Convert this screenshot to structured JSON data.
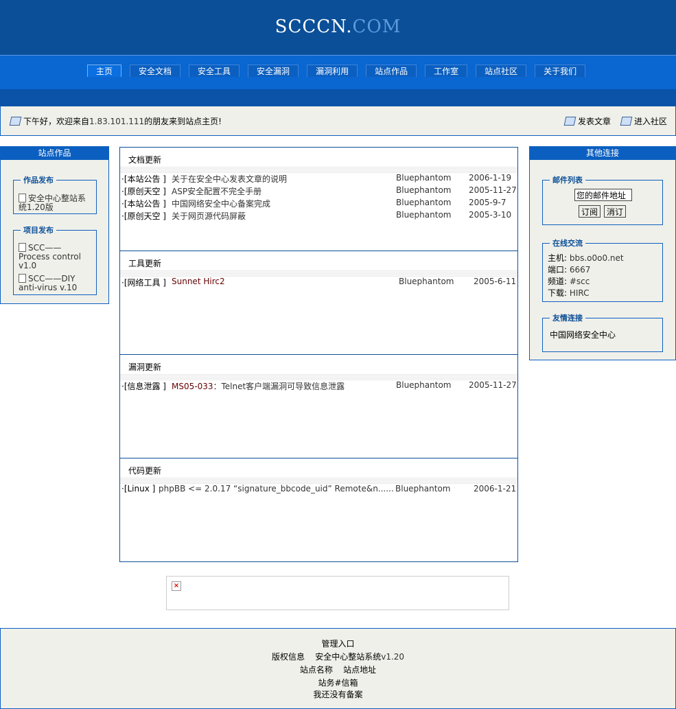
{
  "header": {
    "logo_part1": "SCCCN.",
    "logo_part2": "COM"
  },
  "nav": [
    "主页",
    "安全文档",
    "安全工具",
    "安全漏洞",
    "漏洞利用",
    "站点作品",
    "工作室",
    "站点社区",
    "关于我们"
  ],
  "welcome": {
    "pre": "下午好，欢迎来自",
    "ip": "1.83.101.111",
    "post": "的朋友来到站点主页!",
    "post_article": "发表文章",
    "enter_community": "进入社区"
  },
  "left": {
    "title": "站点作品",
    "works_legend": "作品发布",
    "works_item_line1": "安全中心整站系",
    "works_item_line2": "统1.20版",
    "projects_legend": "项目发布",
    "proj1_line1": "SCC——",
    "proj1_line2": "Process control",
    "proj1_line3": "v1.0",
    "proj2_line1": "SCC——DIY",
    "proj2_line2": "anti-virus v.10"
  },
  "panels": {
    "docs": {
      "title": "文档更新",
      "rows": [
        {
          "cat": "·[本站公告 ]",
          "title": "关于在安全中心发表文章的说明",
          "author": "Bluephantom",
          "date": "2006-1-19"
        },
        {
          "cat": "·[原创天空 ]",
          "title": "ASP安全配置不完全手册",
          "author": "Bluephantom",
          "date": "2005-11-27"
        },
        {
          "cat": "·[本站公告 ]",
          "title": "中国网络安全中心备案完成",
          "author": "Bluephantom",
          "date": "2005-9-7"
        },
        {
          "cat": "·[原创天空 ]",
          "title": "关于网页源代码屏蔽",
          "author": "Bluephantom",
          "date": "2005-3-10"
        }
      ]
    },
    "tools": {
      "title": "工具更新",
      "rows": [
        {
          "cat": "·[网络工具 ]",
          "title": "Sunnet Hirc2",
          "author": "Bluephantom",
          "date": "2005-6-11"
        }
      ]
    },
    "vulns": {
      "title": "漏洞更新",
      "rows": [
        {
          "cat": "·[信息泄露 ]",
          "title_a": "MS05-033",
          "title_b": "：Telnet客户端漏洞可导致信息泄露",
          "author": "Bluephantom",
          "date": "2005-11-27"
        }
      ]
    },
    "code": {
      "title": "代码更新",
      "rows": [
        {
          "cat": "·[Linux ]",
          "title": "phpBB <= 2.0.17 “signature_bbcode_uid” Remote&n......",
          "author": "Bluephantom",
          "date": "2006-1-21"
        }
      ]
    }
  },
  "right": {
    "title": "其他连接",
    "mail_legend": "邮件列表",
    "mail_placeholder": "您的邮件地址",
    "subscribe": "订阅",
    "unsubscribe": "消订",
    "online_legend": "在线交流",
    "host_label": "主机: ",
    "host_val": "bbs.o0o0.net",
    "port_label": "端口: ",
    "port_val": "6667",
    "chan_label": "频道: ",
    "chan_val": "#scc",
    "dl_label": "下载: ",
    "dl_val": "HIRC",
    "friend_legend": "友情连接",
    "friend_item": "中国网络安全中心"
  },
  "footer": {
    "admin": "管理入口",
    "copyright_label": "版权信息",
    "system_name": "安全中心整站系统",
    "version": "v1.20",
    "site_name": "站点名称",
    "site_addr": "站点地址",
    "service_mail": "站务#信箱",
    "record": "我还没有备案"
  }
}
